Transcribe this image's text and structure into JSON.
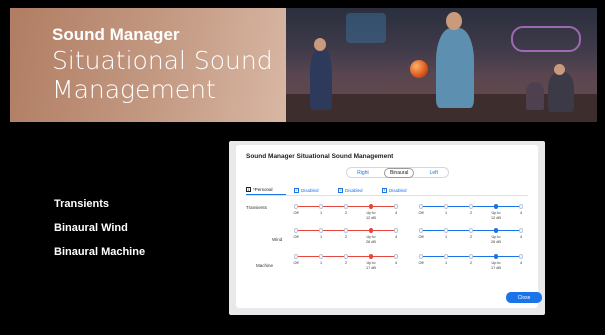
{
  "banner": {
    "title": "Sound Manager",
    "subtitle": "Situational Sound Management"
  },
  "features": [
    "Transients",
    "Binaural Wind",
    "Binaural Machine"
  ],
  "dialog": {
    "title": "Sound Manager Situational Sound Management",
    "ear_options": [
      "Right",
      "Binaural",
      "Left"
    ],
    "selected_ear": "Binaural",
    "program_tabs": [
      {
        "num": "1",
        "label": "*Personal"
      },
      {
        "num": "2",
        "label": "Disabled"
      },
      {
        "num": "3",
        "label": "Disabled"
      },
      {
        "num": "4",
        "label": "Disabled"
      }
    ],
    "rows": [
      {
        "label": "Transients",
        "left_selected_label": "Up to\n12 dB",
        "right_selected_label": "Up to\n12 dB"
      },
      {
        "label": "Wind",
        "left_selected_label": "Up to\n26 dB",
        "right_selected_label": "Up to\n26 dB"
      },
      {
        "label": "Machine",
        "left_selected_label": "Up to\n17 dB",
        "right_selected_label": "Up to\n17 dB"
      }
    ],
    "scale_labels": [
      "Off",
      "1",
      "2",
      "",
      "4"
    ],
    "selected_index": 3,
    "close_label": "Close",
    "colors": {
      "left_accent": "#e4473f",
      "right_accent": "#1a73e8",
      "button": "#1a73e8"
    }
  }
}
